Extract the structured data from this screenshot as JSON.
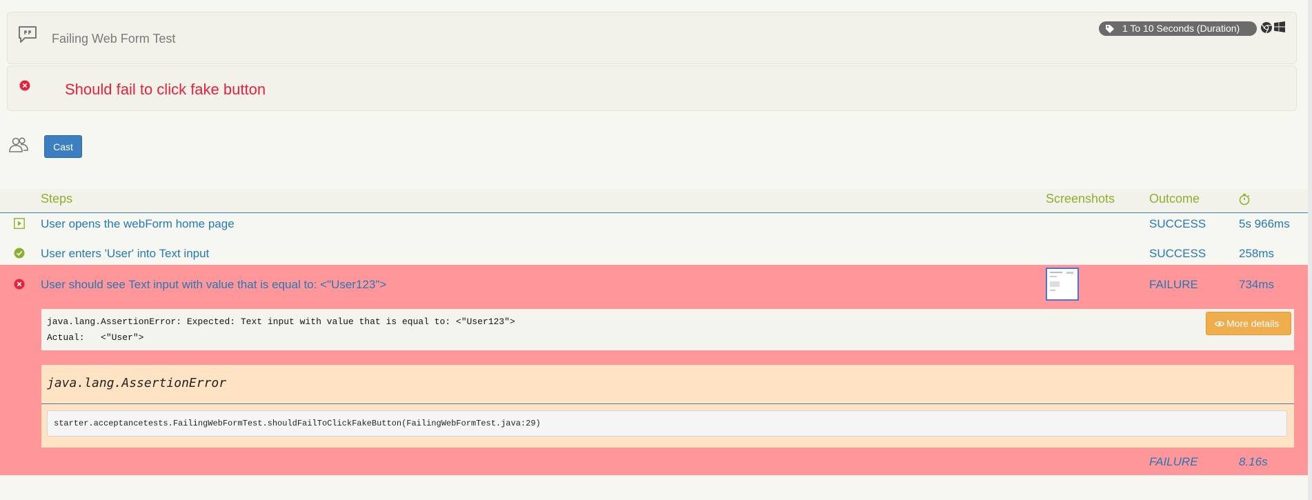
{
  "title_panel": {
    "title": "Failing Web Form Test",
    "tag": "1 To 10 Seconds (Duration)",
    "icons": [
      "quote-icon",
      "tag-icon",
      "chrome-icon",
      "windows-icon"
    ]
  },
  "scenario": {
    "title": "Should fail to click fake button",
    "status_color": "#e8203c"
  },
  "cast": {
    "button_label": "Cast"
  },
  "steps_table": {
    "headers": {
      "steps": "Steps",
      "screenshots": "Screenshots",
      "outcome": "Outcome",
      "duration_icon": "stopwatch-icon"
    },
    "rows": [
      {
        "icon": "play-icon",
        "description": "User opens the webForm home page",
        "outcome": "SUCCESS",
        "duration": "5s 966ms"
      },
      {
        "icon": "check-circle-icon",
        "description": "User enters 'User' into Text input",
        "outcome": "SUCCESS",
        "duration": "258ms"
      },
      {
        "icon": "error-circle-icon",
        "description": "User should see Text input with value that is equal to: <\"User123\">",
        "outcome": "FAILURE",
        "duration": "734ms"
      }
    ],
    "failure": {
      "message_line1": "java.lang.AssertionError: Expected: Text input with value that is equal to: <\"User123\">",
      "message_line2": "Actual:   <\"User\">",
      "more_details": "More details",
      "exception_title": "java.lang.AssertionError",
      "stack_trace": "starter.acceptancetests.FailingWebFormTest.shouldFailToClickFakeButton(FailingWebFormTest.java:29)"
    },
    "summary": {
      "outcome": "FAILURE",
      "duration": "8.16s"
    }
  },
  "colors": {
    "accent_green": "#8bb02e",
    "link_blue": "#2478b8",
    "failure_bg": "#ff9699",
    "button_blue": "#3b7fc0",
    "warning_orange": "#f0ad4e"
  }
}
